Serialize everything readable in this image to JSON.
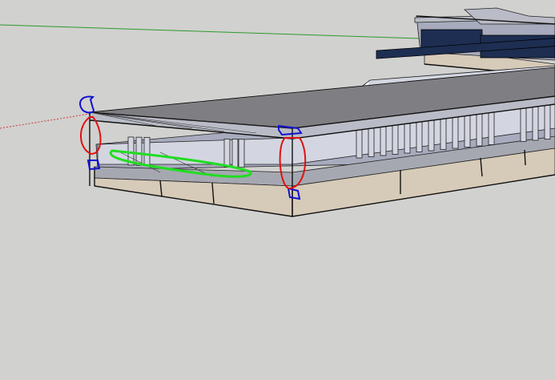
{
  "viewport": {
    "background": "#d1d1cf"
  },
  "colors": {
    "roof_top": "#7f7f83",
    "roof_edge": "#b9bbc6",
    "wall_blue": "#a7abbd",
    "floor_slab": "#d6cab8",
    "floor_top": "#a6a8b1",
    "balcony": "#d3d6e1",
    "windows": "#1d2e52",
    "axis_green": "#2c9a2c",
    "axis_red": "#cc3c3c",
    "markup_blue": "#1010d0",
    "markup_red": "#e01010",
    "markup_green": "#22dd22"
  },
  "icons": {
    "axis_green": "green-axis-line",
    "axis_red": "red-axis-line"
  }
}
